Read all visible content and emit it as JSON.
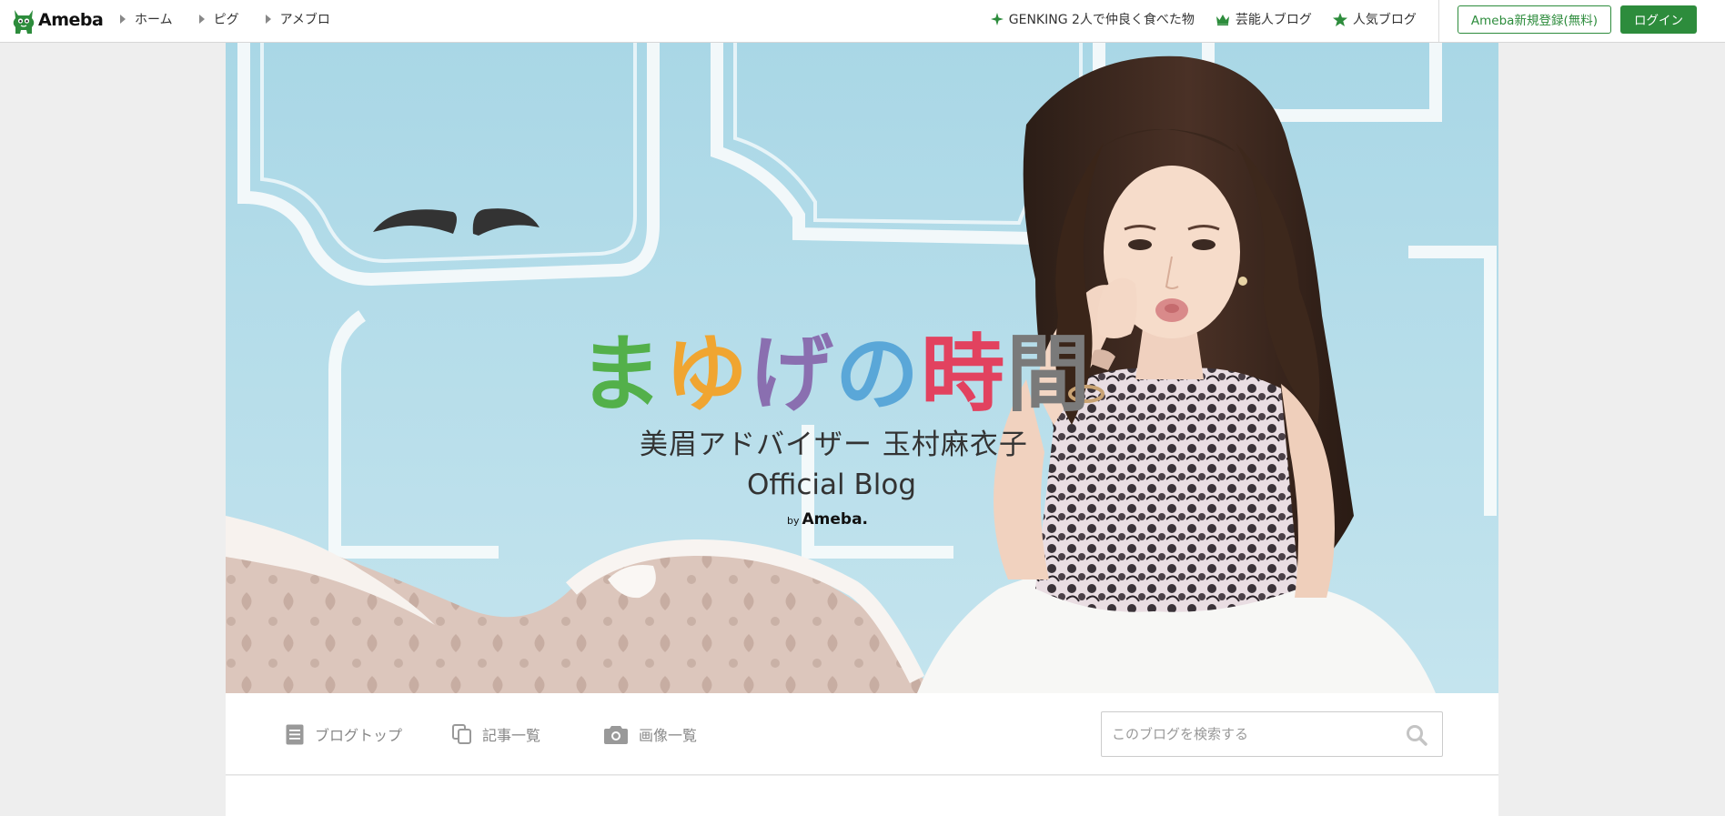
{
  "header": {
    "logo_text": "Ameba",
    "breadcrumbs": [
      "ホーム",
      "ピグ",
      "アメブロ"
    ],
    "links": [
      {
        "label": "GENKING 2人で仲良く食べた物",
        "icon": "sparkle-icon"
      },
      {
        "label": "芸能人ブログ",
        "icon": "crown-icon"
      },
      {
        "label": "人気ブログ",
        "icon": "star-icon"
      }
    ],
    "register_label": "Ameba新規登録(無料)",
    "login_label": "ログイン"
  },
  "hero": {
    "title_chars": [
      "ま",
      "ゆ",
      "げ",
      "の",
      "時",
      "間"
    ],
    "title_colors": [
      "#53b04a",
      "#f0a531",
      "#8a6fb0",
      "#5aa7d8",
      "#e2425f",
      "#7a7a7a"
    ],
    "subtitle": "美眉アドバイザー 玉村麻衣子",
    "official": "Official Blog",
    "by_prefix": "by",
    "by_brand": "Ameba."
  },
  "blognav": {
    "items": [
      {
        "label": "ブログトップ",
        "icon": "document-icon"
      },
      {
        "label": "記事一覧",
        "icon": "copy-icon"
      },
      {
        "label": "画像一覧",
        "icon": "camera-icon"
      }
    ],
    "search_placeholder": "このブログを検索する",
    "search_value": ""
  },
  "colors": {
    "brand_green": "#2d8c3c",
    "page_bg": "#eeeeee",
    "hero_sky": "#b7dde8"
  }
}
